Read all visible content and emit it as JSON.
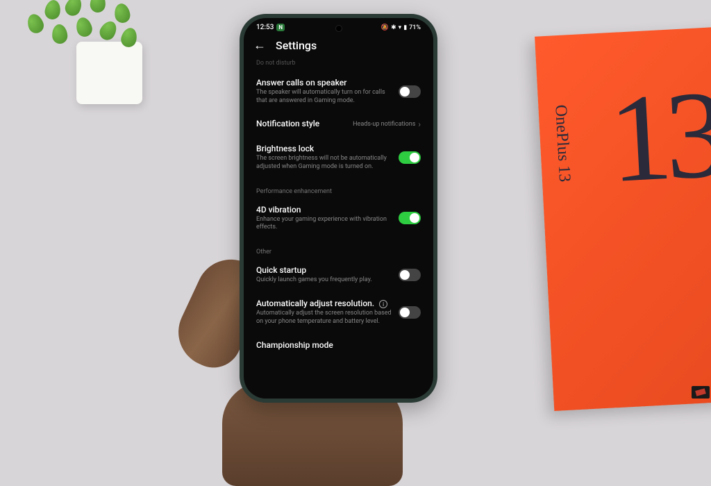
{
  "status_bar": {
    "time": "12:53",
    "badge": "N",
    "battery_text": "71%"
  },
  "header": {
    "title": "Settings"
  },
  "truncated": {
    "top": "Do not disturb",
    "bottom": "Championship mode"
  },
  "settings": {
    "answer_calls": {
      "title": "Answer calls on speaker",
      "desc": "The speaker will automatically turn on for calls that are answered in Gaming mode.",
      "enabled": false
    },
    "notification_style": {
      "title": "Notification style",
      "value": "Heads-up notifications"
    },
    "brightness_lock": {
      "title": "Brightness lock",
      "desc": "The screen brightness will not be automatically adjusted when Gaming mode is turned on.",
      "enabled": true
    },
    "vibration_4d": {
      "title": "4D vibration",
      "desc": "Enhance your gaming experience with vibration effects.",
      "enabled": true
    },
    "quick_startup": {
      "title": "Quick startup",
      "desc": "Quickly launch games you frequently play.",
      "enabled": false
    },
    "auto_resolution": {
      "title": "Automatically adjust resolution.",
      "desc": "Automatically adjust the screen resolution based on your phone temperature and battery level.",
      "enabled": false
    }
  },
  "sections": {
    "performance": "Performance enhancement",
    "other": "Other"
  },
  "box": {
    "number": "13",
    "brand": "OnePlus 13"
  }
}
